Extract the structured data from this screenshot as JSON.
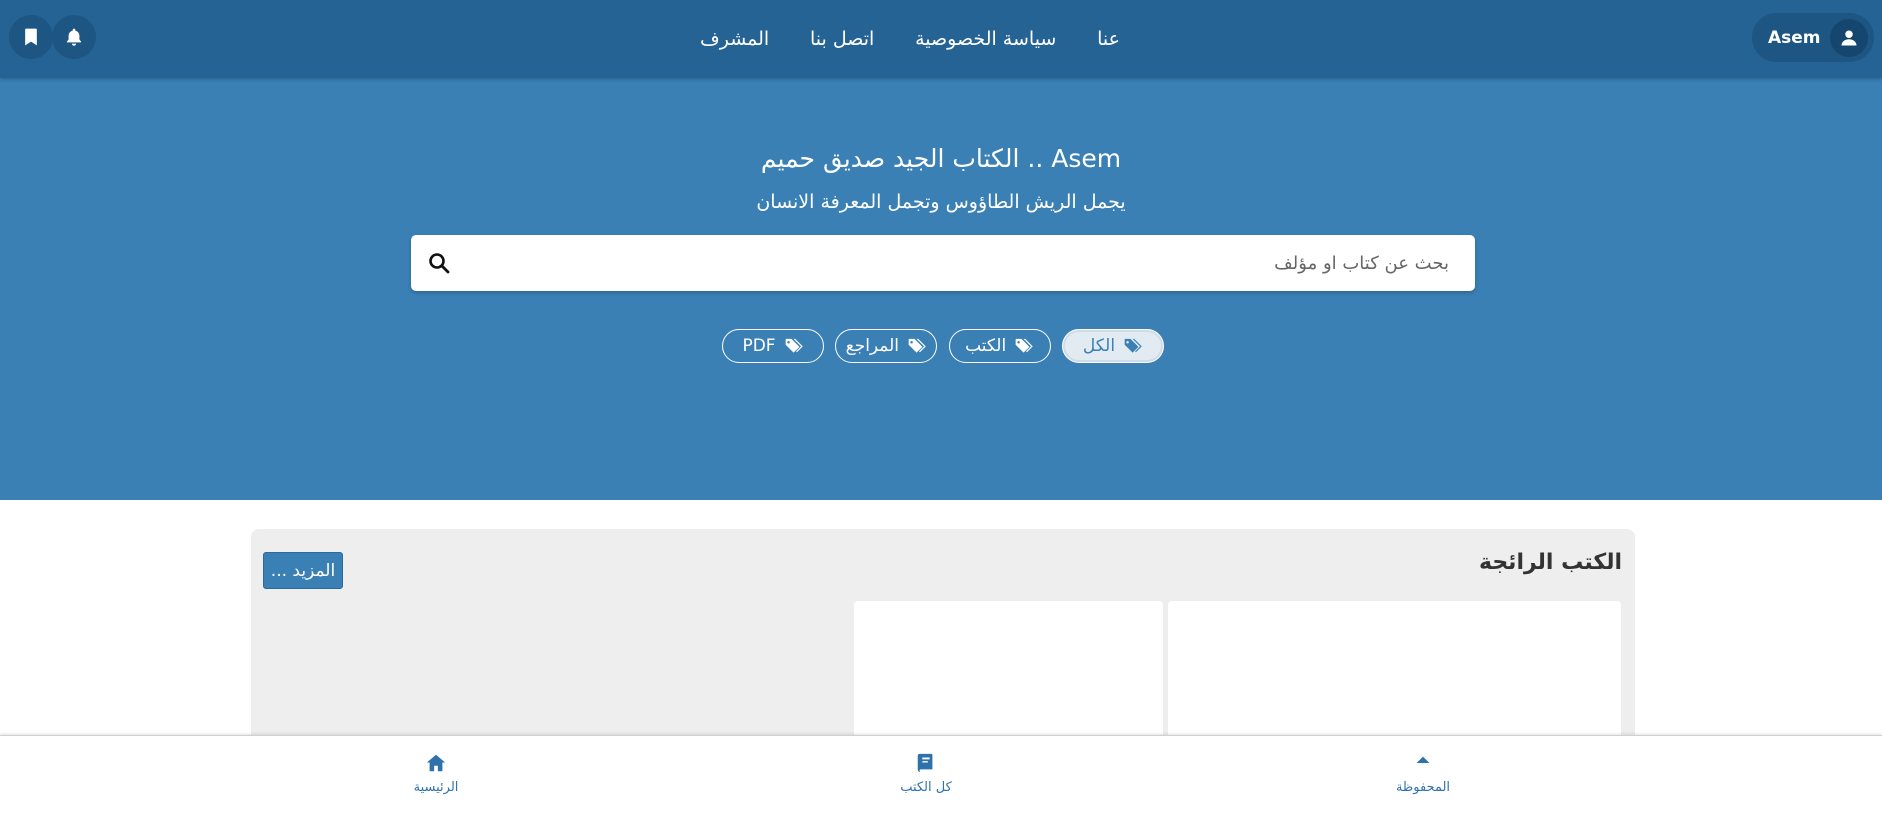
{
  "navbar": {
    "links": [
      "عنا",
      "سياسة الخصوصية",
      "اتصل بنا",
      "المشرف"
    ],
    "user_name": "Asem",
    "icons": {
      "bookmark": "bookmark-icon",
      "notification": "bell-icon",
      "user": "user-icon"
    }
  },
  "hero": {
    "title": "Asem .. الكتاب الجيد صديق حميم",
    "subtitle": "يجمل الريش الطاؤوس وتجمل المعرفة الانسان",
    "search_placeholder": "بحث عن كتاب او مؤلف",
    "search_value": "",
    "filters": [
      {
        "label": "الكل",
        "active": true
      },
      {
        "label": "الكتب",
        "active": false
      },
      {
        "label": "المراجع",
        "active": false
      },
      {
        "label": "PDF",
        "active": false
      }
    ]
  },
  "section": {
    "title": "الكتب الرائجة",
    "more_label": "المزيد ..."
  },
  "bottom_nav": {
    "home": "الرئيسية",
    "all_books": "كل الكتب",
    "saved": "المحفوظة"
  },
  "colors": {
    "navbar": "#256395",
    "hero": "#3b80b5",
    "accent": "#2f72ab",
    "section_bg": "#eeeeee"
  }
}
